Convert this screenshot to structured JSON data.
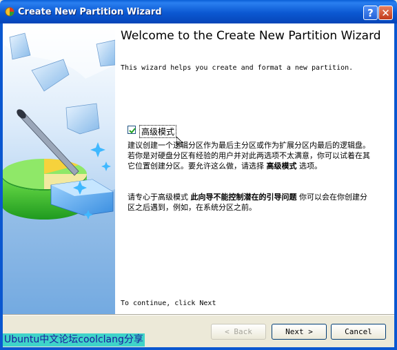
{
  "window": {
    "title": "Create New Partition Wizard",
    "help_glyph": "?",
    "close_glyph": "✕"
  },
  "main": {
    "heading": "Welcome to the Create New Partition Wizard",
    "intro": "This wizard helps you create and format a new partition.",
    "advanced_mode": {
      "label": "高级模式",
      "checked": true
    },
    "paragraph1_a": "建议创建一个逻辑分区作为最后主分区或作为扩展分区内最后的逻辑盘。若你是对硬盘分区有经验的用户并对此两选项不太满意，你可以试着在其它位置创建分区。要允许这么做，请选择 ",
    "paragraph1_bold": "高级模式",
    "paragraph1_b": " 选项。",
    "paragraph2_a": "请专心于高级模式 ",
    "paragraph2_bold": "此向导不能控制潜在的引导问题",
    "paragraph2_b": " 你可以会在你创建分区之后遇到，例如，在系统分区之前。",
    "continue_text": "To continue, click Next"
  },
  "buttons": {
    "back": "< Back",
    "next": "Next >",
    "cancel": "Cancel"
  },
  "watermark": "Ubuntu中文论坛coolclang分享",
  "colors": {
    "titlebar": "#0b58d2",
    "window_bg": "#ece9d8",
    "watermark_bg": "#3fd3c9",
    "watermark_text": "#1b1b9a"
  },
  "icons": {
    "title": "wizard-app-icon",
    "side_art": "pie-chart-wand-illustration"
  }
}
